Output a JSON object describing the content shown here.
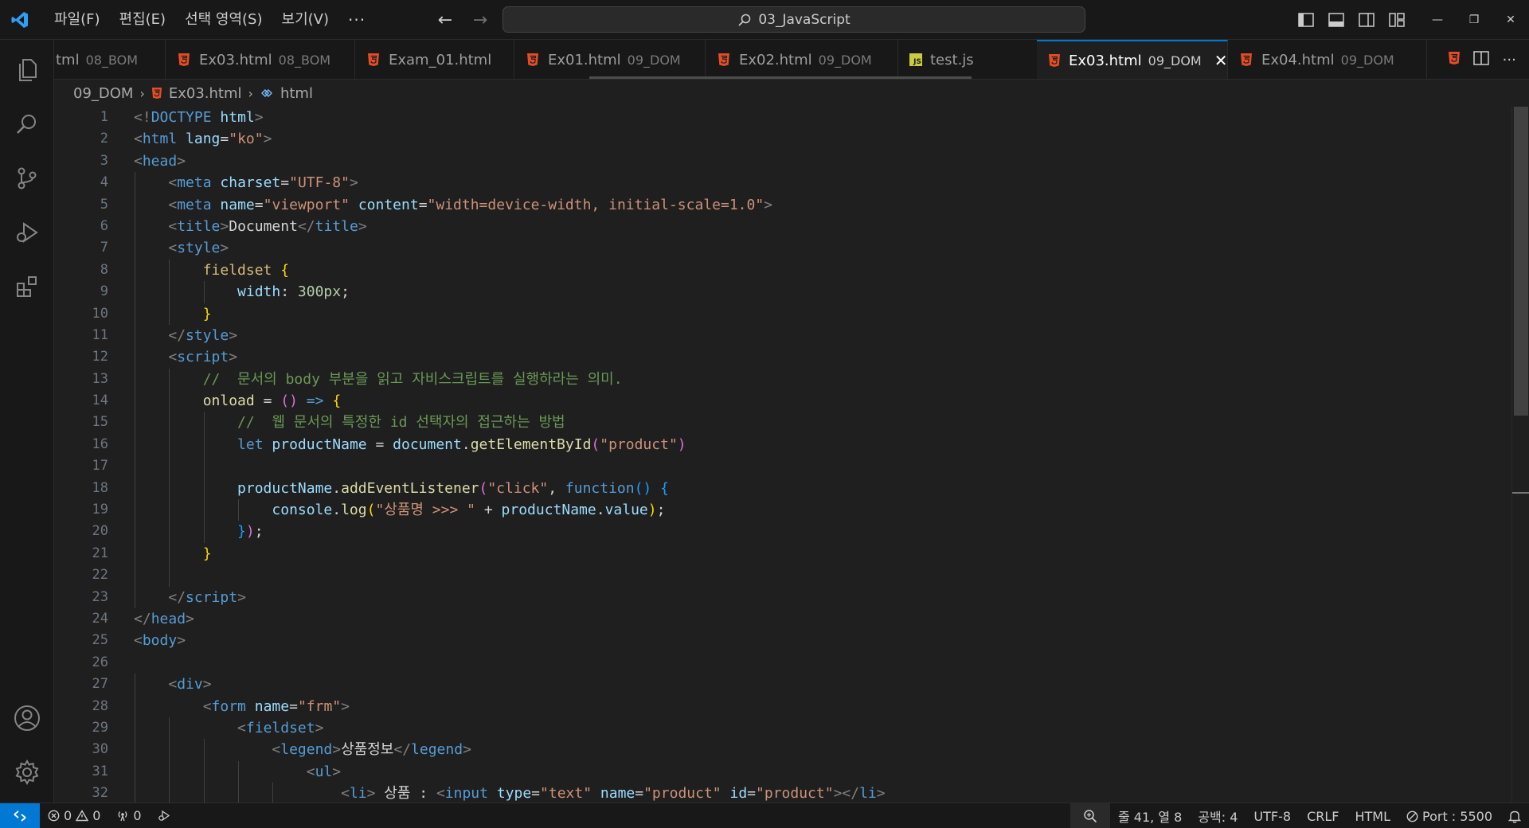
{
  "menu": {
    "file": "파일(F)",
    "edit": "편집(E)",
    "selection": "선택 영역(S)",
    "view": "보기(V)",
    "more": "···"
  },
  "search": {
    "text": "03_JavaScript"
  },
  "tabs": [
    {
      "name": "tml",
      "desc": "08_BOM",
      "icon": "html5-icon"
    },
    {
      "name": "Ex03.html",
      "desc": "08_BOM",
      "icon": "html5-icon"
    },
    {
      "name": "Exam_01.html",
      "desc": "",
      "icon": "html5-icon"
    },
    {
      "name": "Ex01.html",
      "desc": "09_DOM",
      "icon": "html5-icon"
    },
    {
      "name": "Ex02.html",
      "desc": "09_DOM",
      "icon": "html5-icon"
    },
    {
      "name": "test.js",
      "desc": "",
      "icon": "javascript-icon"
    },
    {
      "name": "Ex03.html",
      "desc": "09_DOM",
      "icon": "html5-icon",
      "active": true
    },
    {
      "name": "Ex04.html",
      "desc": "09_DOM",
      "icon": "html5-icon"
    }
  ],
  "tab_js_badge": "JS",
  "breadcrumb": {
    "folder": "09_DOM",
    "file": "Ex03.html",
    "symbol": "html"
  },
  "line_numbers": [
    "1",
    "2",
    "3",
    "4",
    "5",
    "6",
    "7",
    "8",
    "9",
    "10",
    "11",
    "12",
    "13",
    "14",
    "15",
    "16",
    "17",
    "18",
    "19",
    "20",
    "21",
    "22",
    "23",
    "24",
    "25",
    "26",
    "27",
    "28",
    "29",
    "30",
    "31",
    "32"
  ],
  "code": [
    [
      [
        "pun",
        "<!"
      ],
      [
        "tag",
        "DOCTYPE"
      ],
      [
        "txt",
        " "
      ],
      [
        "attr",
        "html"
      ],
      [
        "pun",
        ">"
      ]
    ],
    [
      [
        "pun",
        "<"
      ],
      [
        "tag",
        "html"
      ],
      [
        "txt",
        " "
      ],
      [
        "attr",
        "lang"
      ],
      [
        "txt",
        "="
      ],
      [
        "str",
        "\"ko\""
      ],
      [
        "pun",
        ">"
      ]
    ],
    [
      [
        "pun",
        "<"
      ],
      [
        "tag",
        "head"
      ],
      [
        "pun",
        ">"
      ]
    ],
    [
      [
        "txt",
        "    "
      ],
      [
        "pun",
        "<"
      ],
      [
        "tag",
        "meta"
      ],
      [
        "txt",
        " "
      ],
      [
        "attr",
        "charset"
      ],
      [
        "txt",
        "="
      ],
      [
        "str",
        "\"UTF-8\""
      ],
      [
        "pun",
        ">"
      ]
    ],
    [
      [
        "txt",
        "    "
      ],
      [
        "pun",
        "<"
      ],
      [
        "tag",
        "meta"
      ],
      [
        "txt",
        " "
      ],
      [
        "attr",
        "name"
      ],
      [
        "txt",
        "="
      ],
      [
        "str",
        "\"viewport\""
      ],
      [
        "txt",
        " "
      ],
      [
        "attr",
        "content"
      ],
      [
        "txt",
        "="
      ],
      [
        "str",
        "\"width=device-width, initial-scale=1.0\""
      ],
      [
        "pun",
        ">"
      ]
    ],
    [
      [
        "txt",
        "    "
      ],
      [
        "pun",
        "<"
      ],
      [
        "tag",
        "title"
      ],
      [
        "pun",
        ">"
      ],
      [
        "txt",
        "Document"
      ],
      [
        "pun",
        "</"
      ],
      [
        "tag",
        "title"
      ],
      [
        "pun",
        ">"
      ]
    ],
    [
      [
        "txt",
        "    "
      ],
      [
        "pun",
        "<"
      ],
      [
        "tag",
        "style"
      ],
      [
        "pun",
        ">"
      ]
    ],
    [
      [
        "txt",
        "        "
      ],
      [
        "sel",
        "fieldset"
      ],
      [
        "txt",
        " "
      ],
      [
        "br1",
        "{"
      ]
    ],
    [
      [
        "txt",
        "            "
      ],
      [
        "var",
        "width"
      ],
      [
        "txt",
        ": "
      ],
      [
        "num",
        "300px"
      ],
      [
        "txt",
        ";"
      ]
    ],
    [
      [
        "txt",
        "        "
      ],
      [
        "br1",
        "}"
      ]
    ],
    [
      [
        "txt",
        "    "
      ],
      [
        "pun",
        "</"
      ],
      [
        "tag",
        "style"
      ],
      [
        "pun",
        ">"
      ]
    ],
    [
      [
        "txt",
        "    "
      ],
      [
        "pun",
        "<"
      ],
      [
        "tag",
        "script"
      ],
      [
        "pun",
        ">"
      ]
    ],
    [
      [
        "txt",
        "        "
      ],
      [
        "cmt",
        "//  문서의 body 부분을 읽고 자비스크립트를 실행하라는 의미."
      ]
    ],
    [
      [
        "txt",
        "        "
      ],
      [
        "fn",
        "onload"
      ],
      [
        "txt",
        " = "
      ],
      [
        "br2",
        "()"
      ],
      [
        "txt",
        " "
      ],
      [
        "kw",
        "=>"
      ],
      [
        "txt",
        " "
      ],
      [
        "br1",
        "{"
      ]
    ],
    [
      [
        "txt",
        "            "
      ],
      [
        "cmt",
        "//  웹 문서의 특정한 id 선택자의 접근하는 방법"
      ]
    ],
    [
      [
        "txt",
        "            "
      ],
      [
        "kw",
        "let"
      ],
      [
        "txt",
        " "
      ],
      [
        "var",
        "productName"
      ],
      [
        "txt",
        " = "
      ],
      [
        "var",
        "document"
      ],
      [
        "txt",
        "."
      ],
      [
        "fn",
        "getElementById"
      ],
      [
        "br2",
        "("
      ],
      [
        "str",
        "\"product\""
      ],
      [
        "br2",
        ")"
      ]
    ],
    [],
    [
      [
        "txt",
        "            "
      ],
      [
        "var",
        "productName"
      ],
      [
        "txt",
        "."
      ],
      [
        "fn",
        "addEventListener"
      ],
      [
        "br2",
        "("
      ],
      [
        "str",
        "\"click\""
      ],
      [
        "txt",
        ", "
      ],
      [
        "kw",
        "function"
      ],
      [
        "br3",
        "()"
      ],
      [
        "txt",
        " "
      ],
      [
        "br3",
        "{"
      ]
    ],
    [
      [
        "txt",
        "                "
      ],
      [
        "var",
        "console"
      ],
      [
        "txt",
        "."
      ],
      [
        "fn",
        "log"
      ],
      [
        "br1",
        "("
      ],
      [
        "str",
        "\"상품명 >>> \""
      ],
      [
        "txt",
        " + "
      ],
      [
        "var",
        "productName"
      ],
      [
        "txt",
        "."
      ],
      [
        "var",
        "value"
      ],
      [
        "br1",
        ")"
      ],
      [
        "txt",
        ";"
      ]
    ],
    [
      [
        "txt",
        "            "
      ],
      [
        "br3",
        "}"
      ],
      [
        "br2",
        ")"
      ],
      [
        "txt",
        ";"
      ]
    ],
    [
      [
        "txt",
        "        "
      ],
      [
        "br1",
        "}"
      ]
    ],
    [],
    [
      [
        "txt",
        "    "
      ],
      [
        "pun",
        "</"
      ],
      [
        "tag",
        "script"
      ],
      [
        "pun",
        ">"
      ]
    ],
    [
      [
        "pun",
        "</"
      ],
      [
        "tag",
        "head"
      ],
      [
        "pun",
        ">"
      ]
    ],
    [
      [
        "pun",
        "<"
      ],
      [
        "tag",
        "body"
      ],
      [
        "pun",
        ">"
      ]
    ],
    [],
    [
      [
        "txt",
        "    "
      ],
      [
        "pun",
        "<"
      ],
      [
        "tag",
        "div"
      ],
      [
        "pun",
        ">"
      ]
    ],
    [
      [
        "txt",
        "        "
      ],
      [
        "pun",
        "<"
      ],
      [
        "tag",
        "form"
      ],
      [
        "txt",
        " "
      ],
      [
        "attr",
        "name"
      ],
      [
        "txt",
        "="
      ],
      [
        "str",
        "\"frm\""
      ],
      [
        "pun",
        ">"
      ]
    ],
    [
      [
        "txt",
        "            "
      ],
      [
        "pun",
        "<"
      ],
      [
        "tag",
        "fieldset"
      ],
      [
        "pun",
        ">"
      ]
    ],
    [
      [
        "txt",
        "                "
      ],
      [
        "pun",
        "<"
      ],
      [
        "tag",
        "legend"
      ],
      [
        "pun",
        ">"
      ],
      [
        "txt",
        "상품정보"
      ],
      [
        "pun",
        "</"
      ],
      [
        "tag",
        "legend"
      ],
      [
        "pun",
        ">"
      ]
    ],
    [
      [
        "txt",
        "                    "
      ],
      [
        "pun",
        "<"
      ],
      [
        "tag",
        "ul"
      ],
      [
        "pun",
        ">"
      ]
    ],
    [
      [
        "txt",
        "                        "
      ],
      [
        "pun",
        "<"
      ],
      [
        "tag",
        "li"
      ],
      [
        "pun",
        ">"
      ],
      [
        "txt",
        " 상품 : "
      ],
      [
        "pun",
        "<"
      ],
      [
        "tag",
        "input"
      ],
      [
        "txt",
        " "
      ],
      [
        "attr",
        "type"
      ],
      [
        "txt",
        "="
      ],
      [
        "str",
        "\"text\""
      ],
      [
        "txt",
        " "
      ],
      [
        "attr",
        "name"
      ],
      [
        "txt",
        "="
      ],
      [
        "str",
        "\"product\""
      ],
      [
        "txt",
        " "
      ],
      [
        "attr",
        "id"
      ],
      [
        "txt",
        "="
      ],
      [
        "str",
        "\"product\""
      ],
      [
        "pun",
        "></"
      ],
      [
        "tag",
        "li"
      ],
      [
        "pun",
        ">"
      ]
    ]
  ],
  "status": {
    "errors": "0",
    "warnings": "0",
    "ports": "0",
    "position": "줄 41, 열 8",
    "spaces": "공백: 4",
    "encoding": "UTF-8",
    "eol": "CRLF",
    "language": "HTML",
    "port": "Port : 5500"
  },
  "colors": {
    "accent": "#0078d4",
    "html_icon": "#e44d26",
    "js_icon": "#cbcb41"
  }
}
